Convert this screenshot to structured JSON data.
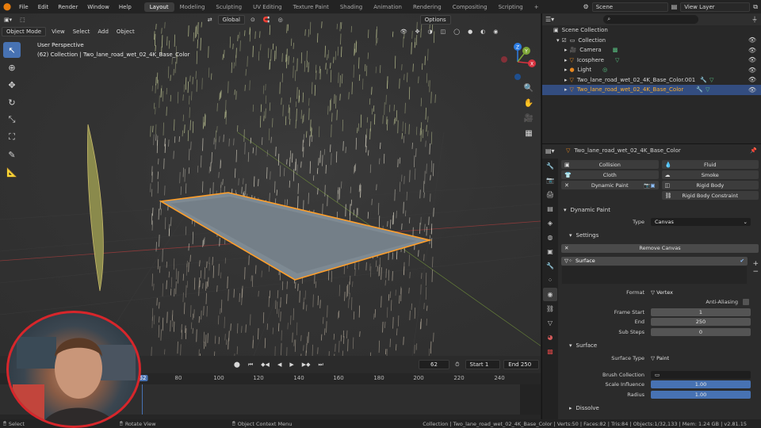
{
  "menu": [
    "File",
    "Edit",
    "Render",
    "Window",
    "Help"
  ],
  "workspaces": [
    "Layout",
    "Modeling",
    "Sculpting",
    "UV Editing",
    "Texture Paint",
    "Shading",
    "Animation",
    "Rendering",
    "Compositing",
    "Scripting"
  ],
  "active_workspace": "Layout",
  "scene": "Scene",
  "view_layer": "View Layer",
  "viewport": {
    "transform_orientation": "Global",
    "options_label": "Options",
    "mode": "Object Mode",
    "menus": [
      "View",
      "Select",
      "Add",
      "Object"
    ],
    "perspective_label": "User Perspective",
    "collection_label": "(62) Collection | Two_lane_road_wet_02_4K_Base_Color",
    "gizmo_axes": [
      "X",
      "Y",
      "Z"
    ]
  },
  "timeline": {
    "current_frame": "62",
    "start_label": "Start",
    "start": "1",
    "end_label": "End",
    "end": "250",
    "ticks": [
      "62",
      "80",
      "100",
      "120",
      "140",
      "160",
      "180",
      "200",
      "220",
      "240"
    ]
  },
  "outliner": {
    "root": "Scene Collection",
    "items": [
      {
        "label": "Collection",
        "indent": 1
      },
      {
        "label": "Camera",
        "indent": 2
      },
      {
        "label": "Icosphere",
        "indent": 2
      },
      {
        "label": "Light",
        "indent": 2
      },
      {
        "label": "Two_lane_road_wet_02_4K_Base_Color.001",
        "indent": 2
      },
      {
        "label": "Two_lane_road_wet_02_4K_Base_Color",
        "indent": 2,
        "selected": true
      }
    ]
  },
  "properties": {
    "object_name": "Two_lane_road_wet_02_4K_Base_Color",
    "physics_buttons": {
      "collision": "Collision",
      "fluid": "Fluid",
      "cloth": "Cloth",
      "smoke": "Smoke",
      "dynamic_paint": "Dynamic Paint",
      "rigid_body": "Rigid Body",
      "rigid_body_constraint": "Rigid Body Constraint"
    },
    "dynamic_paint_header": "Dynamic Paint",
    "type_label": "Type",
    "type_value": "Canvas",
    "settings_header": "Settings",
    "remove_canvas": "Remove Canvas",
    "surface_item": "Surface",
    "format_label": "Format",
    "format_value": "Vertex",
    "anti_aliasing": "Anti-Aliasing",
    "frame_start_label": "Frame Start",
    "frame_start": "1",
    "end_label": "End",
    "end_value": "250",
    "sub_steps_label": "Sub Steps",
    "sub_steps": "0",
    "surface_header": "Surface",
    "surface_type_label": "Surface Type",
    "surface_type_value": "Paint",
    "brush_collection_label": "Brush Collection",
    "scale_influence_label": "Scale Influence",
    "scale_influence": "1.00",
    "radius_label": "Radius",
    "radius": "1.00",
    "dissolve": "Dissolve"
  },
  "statusbar": {
    "select": "Select",
    "rotate": "Rotate View",
    "context": "Object Context Menu",
    "stats": "Collection | Two_lane_road_wet_02_4K_Base_Color | Verts:50 | Faces:82 | Tris:84 | Objects:1/32,133 | Mem: 1.24 GB | v2.81.15"
  },
  "colors": {
    "accent_blue": "#4772b3",
    "selection_orange": "#e8881f",
    "webcam_border": "#d7262b",
    "playhead": "#4772b3"
  }
}
